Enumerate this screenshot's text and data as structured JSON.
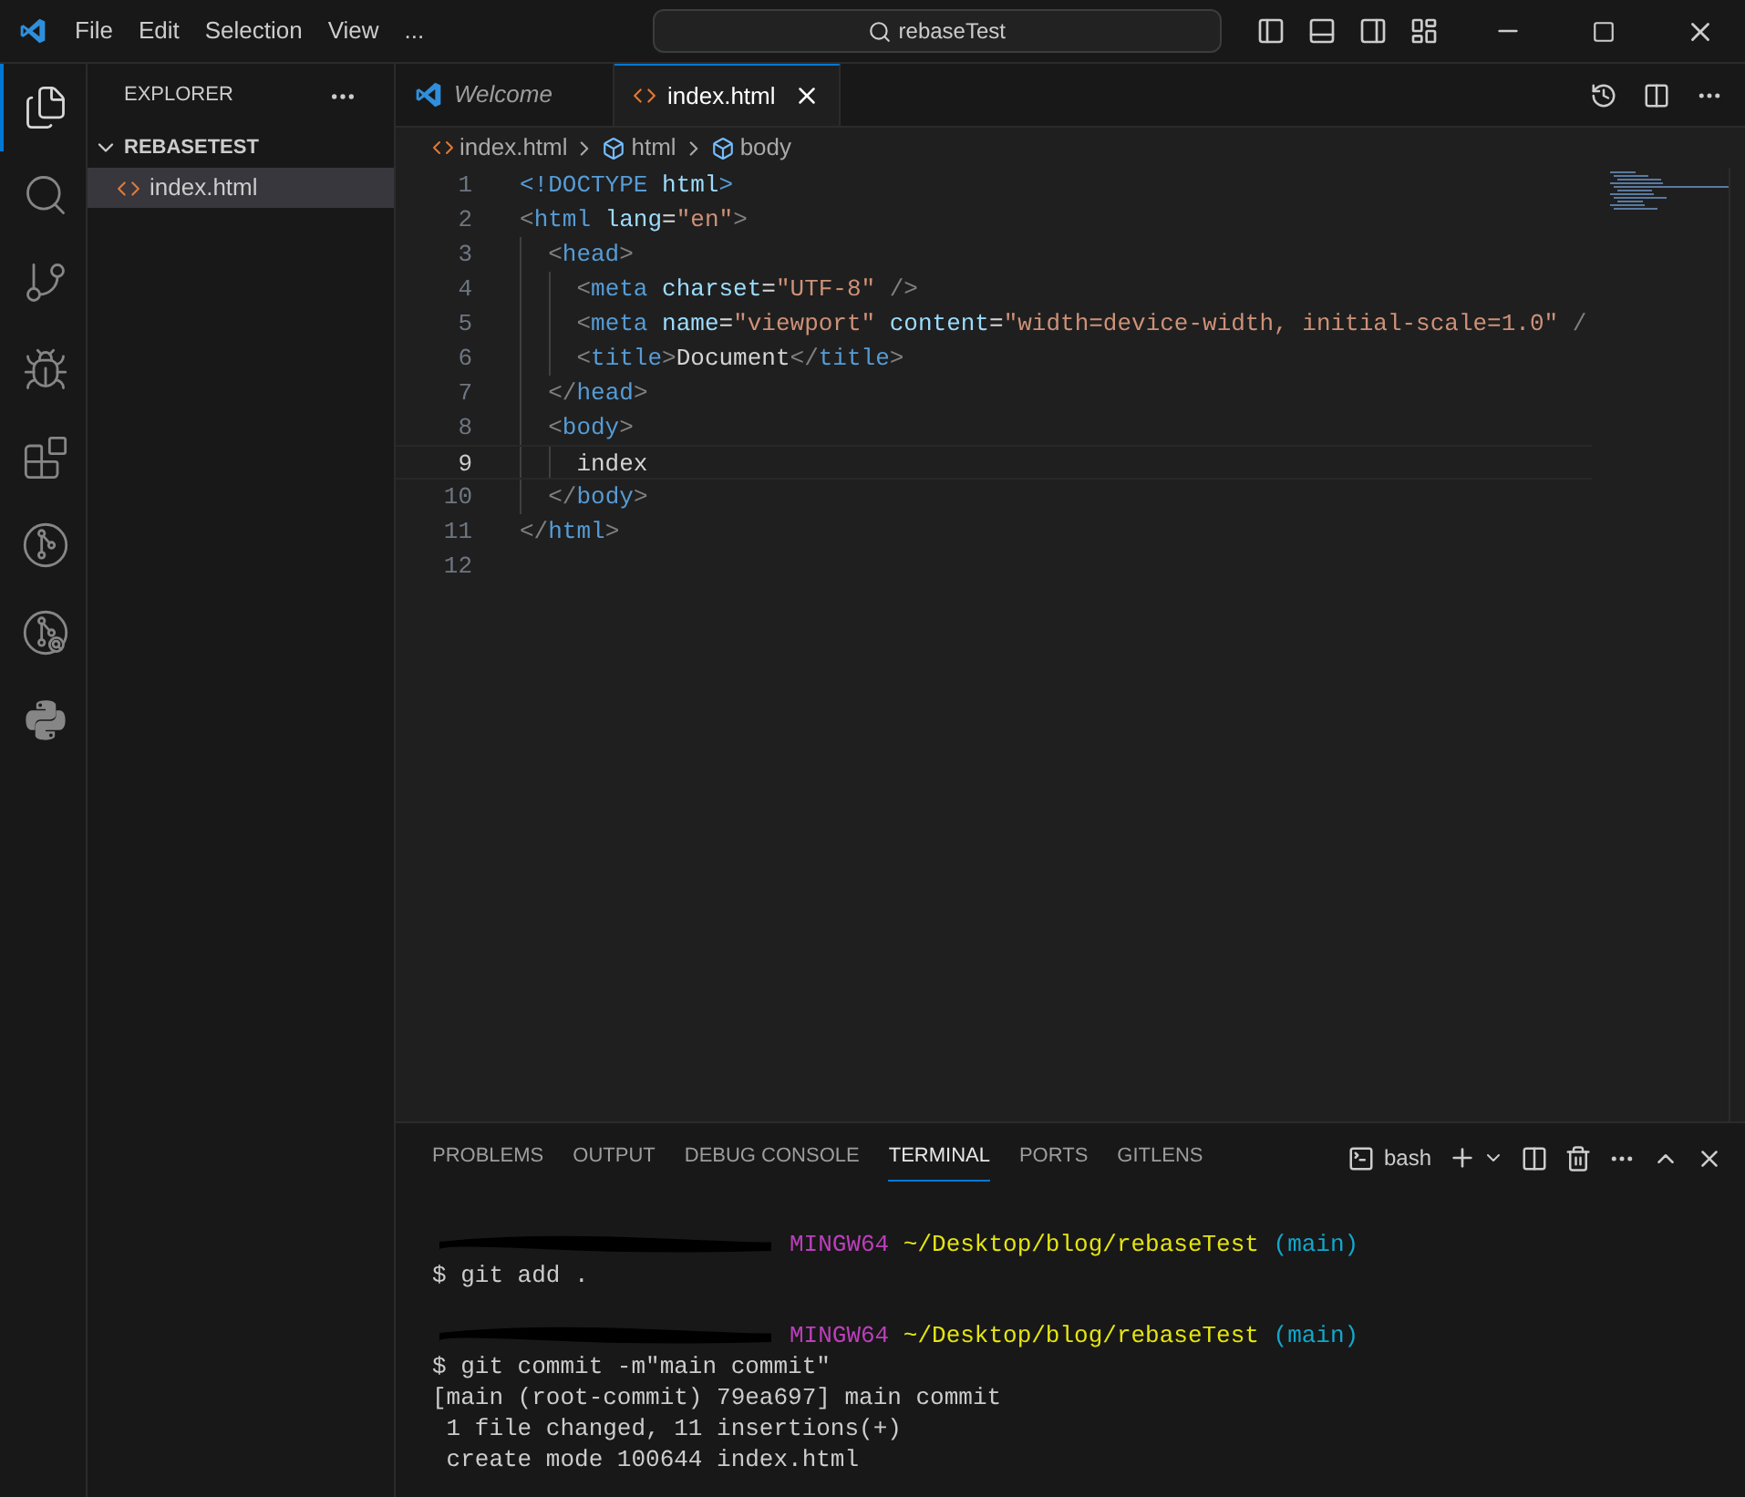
{
  "title_bar": {
    "menu": [
      "File",
      "Edit",
      "Selection",
      "View",
      "..."
    ],
    "search": {
      "value": "rebaseTest"
    }
  },
  "activity_bar": {
    "items": [
      {
        "kind": "files",
        "selected": true
      },
      {
        "kind": "search",
        "selected": false
      },
      {
        "kind": "source-control",
        "selected": false
      },
      {
        "kind": "run-debug",
        "selected": false
      },
      {
        "kind": "extensions",
        "selected": false
      },
      {
        "kind": "git-graph",
        "selected": false
      },
      {
        "kind": "git-inspect",
        "selected": false
      },
      {
        "kind": "python",
        "selected": false
      }
    ]
  },
  "sidebar": {
    "title": "EXPLORER",
    "folder": {
      "name": "REBASETEST",
      "expanded": true,
      "children": [
        {
          "name": "index.html",
          "selected": true
        }
      ]
    }
  },
  "tabs": [
    {
      "label": "Welcome",
      "kind": "welcome",
      "selected": false
    },
    {
      "label": "index.html",
      "kind": "html",
      "selected": true
    }
  ],
  "breadcrumb": [
    "index.html",
    "html",
    "body"
  ],
  "editor": {
    "lines": [
      {
        "number": "1",
        "current": false,
        "tokens": [
          {
            "kind": "tag",
            "text": "<!DOCTYPE"
          },
          {
            "kind": "attr",
            "text": " html"
          },
          {
            "kind": "tag",
            "text": ">"
          }
        ]
      },
      {
        "number": "2",
        "current": false,
        "tokens": [
          {
            "kind": "punct",
            "text": "<"
          },
          {
            "kind": "tag",
            "text": "html"
          },
          {
            "kind": "attr",
            "text": " lang"
          },
          {
            "kind": "text",
            "text": "="
          },
          {
            "kind": "string",
            "text": "\"en\""
          },
          {
            "kind": "punct",
            "text": ">"
          }
        ]
      },
      {
        "number": "3",
        "current": false,
        "tokens": [
          {
            "kind": "punct",
            "text": "  <"
          },
          {
            "kind": "tag",
            "text": "head"
          },
          {
            "kind": "punct",
            "text": ">"
          }
        ]
      },
      {
        "number": "4",
        "current": false,
        "tokens": [
          {
            "kind": "punct",
            "text": "    <"
          },
          {
            "kind": "tag",
            "text": "meta"
          },
          {
            "kind": "attr",
            "text": " charset"
          },
          {
            "kind": "text",
            "text": "="
          },
          {
            "kind": "string",
            "text": "\"UTF-8\""
          },
          {
            "kind": "punct",
            "text": " />"
          }
        ]
      },
      {
        "number": "5",
        "current": false,
        "tokens": [
          {
            "kind": "punct",
            "text": "    <"
          },
          {
            "kind": "tag",
            "text": "meta"
          },
          {
            "kind": "attr",
            "text": " name"
          },
          {
            "kind": "text",
            "text": "="
          },
          {
            "kind": "string",
            "text": "\"viewport\""
          },
          {
            "kind": "attr",
            "text": " content"
          },
          {
            "kind": "text",
            "text": "="
          },
          {
            "kind": "string",
            "text": "\"width=device-width, initial-scale=1.0\""
          },
          {
            "kind": "punct",
            "text": " /"
          }
        ]
      },
      {
        "number": "6",
        "current": false,
        "tokens": [
          {
            "kind": "punct",
            "text": "    <"
          },
          {
            "kind": "tag",
            "text": "title"
          },
          {
            "kind": "punct",
            "text": ">"
          },
          {
            "kind": "text",
            "text": "Document"
          },
          {
            "kind": "punct",
            "text": "</"
          },
          {
            "kind": "tag",
            "text": "title"
          },
          {
            "kind": "punct",
            "text": ">"
          }
        ]
      },
      {
        "number": "7",
        "current": false,
        "tokens": [
          {
            "kind": "punct",
            "text": "  </"
          },
          {
            "kind": "tag",
            "text": "head"
          },
          {
            "kind": "punct",
            "text": ">"
          }
        ]
      },
      {
        "number": "8",
        "current": false,
        "tokens": [
          {
            "kind": "punct",
            "text": "  <"
          },
          {
            "kind": "tag",
            "text": "body"
          },
          {
            "kind": "punct",
            "text": ">"
          }
        ]
      },
      {
        "number": "9",
        "current": true,
        "tokens": [
          {
            "kind": "text",
            "text": "    index"
          }
        ]
      },
      {
        "number": "10",
        "current": false,
        "tokens": [
          {
            "kind": "punct",
            "text": "  </"
          },
          {
            "kind": "tag",
            "text": "body"
          },
          {
            "kind": "punct",
            "text": ">"
          }
        ]
      },
      {
        "number": "11",
        "current": false,
        "tokens": [
          {
            "kind": "punct",
            "text": "</"
          },
          {
            "kind": "tag",
            "text": "html"
          },
          {
            "kind": "punct",
            "text": ">"
          }
        ]
      },
      {
        "number": "12",
        "current": false
      }
    ]
  },
  "panel": {
    "tabs": [
      {
        "label": "PROBLEMS",
        "selected": false
      },
      {
        "label": "OUTPUT",
        "selected": false
      },
      {
        "label": "DEBUG CONSOLE",
        "selected": false
      },
      {
        "label": "TERMINAL",
        "selected": true
      },
      {
        "label": "PORTS",
        "selected": false
      },
      {
        "label": "GITLENS",
        "selected": false
      }
    ],
    "shell": "bash",
    "terminal": [
      {
        "kind": "blank"
      },
      {
        "kind": "prompt",
        "system": "MINGW64",
        "path": "~/Desktop/blog/rebaseTest",
        "branch": "(main)"
      },
      {
        "kind": "output",
        "text": "$ git add ."
      },
      {
        "kind": "blank"
      },
      {
        "kind": "prompt",
        "system": "MINGW64",
        "path": "~/Desktop/blog/rebaseTest",
        "branch": "(main)"
      },
      {
        "kind": "output",
        "text": "$ git commit -m\"main commit\""
      },
      {
        "kind": "output",
        "text": "[main (root-commit) 79ea697] main commit"
      },
      {
        "kind": "output",
        "text": " 1 file changed, 11 insertions(+)"
      },
      {
        "kind": "output",
        "text": " create mode 100644 index.html"
      }
    ]
  }
}
